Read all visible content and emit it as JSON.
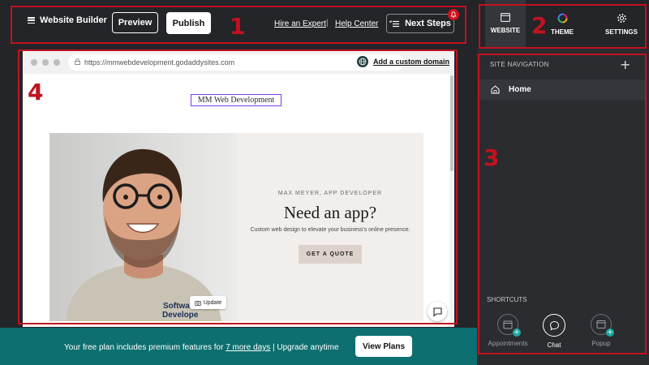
{
  "topbar": {
    "menu_label": "Website Builder",
    "preview_label": "Preview",
    "publish_label": "Publish",
    "hire_label": "Hire an Expert",
    "separator": "|",
    "help_label": "Help Center",
    "next_steps_label": "Next Steps"
  },
  "side_tabs": [
    {
      "label": "WEBSITE",
      "icon": "browser-window-icon",
      "active": true
    },
    {
      "label": "THEME",
      "icon": "color-wheel-icon",
      "active": false
    },
    {
      "label": "SETTINGS",
      "icon": "gear-icon",
      "active": false
    }
  ],
  "site_nav": {
    "title": "SITE NAVIGATION",
    "add_icon": "plus-icon",
    "items": [
      {
        "label": "Home",
        "icon": "home-icon"
      }
    ]
  },
  "shortcuts": {
    "title": "SHORTCUTS",
    "items": [
      {
        "label": "Appointments",
        "icon": "calendar-icon"
      },
      {
        "label": "Chat",
        "icon": "chat-bubble-icon"
      },
      {
        "label": "Popup",
        "icon": "popup-window-icon"
      }
    ]
  },
  "browser": {
    "url": "https://mmwebdevelopment.godaddysites.com",
    "add_domain_label": "Add a custom domain"
  },
  "site": {
    "title": "MM Web Development",
    "eyebrow": "MAX MEYER, APP DEVELOPER",
    "headline": "Need an app?",
    "subtext": "Custom web design to elevate your business's online presence.",
    "cta_label": "GET A QUOTE",
    "update_label": "Update",
    "shirt_text_1": "Softwar",
    "shirt_text_2": "Develope"
  },
  "banner": {
    "text_before": "Your free plan includes premium features for ",
    "days_link": "7 more days",
    "text_after": " | Upgrade anytime",
    "view_plans_label": "View Plans"
  },
  "annotations": {
    "one": "1",
    "two": "2",
    "three": "3",
    "four": "4"
  },
  "colors": {
    "accent_red": "#c1121f",
    "banner_teal": "#0d6f6f",
    "panel_dark": "#2a2c30",
    "nav_highlight": "#a78bfa"
  }
}
